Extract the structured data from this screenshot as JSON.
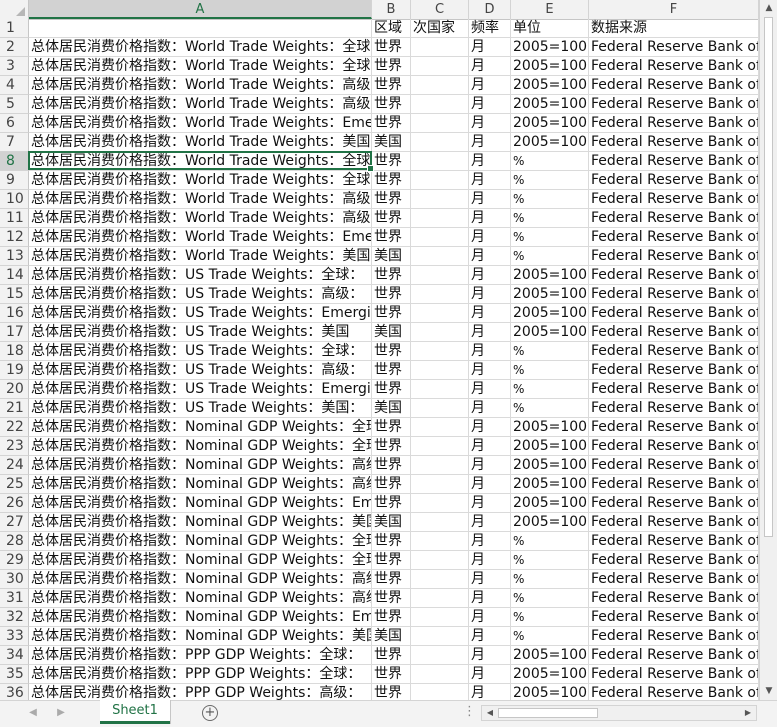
{
  "columns": [
    {
      "letter": "A"
    },
    {
      "letter": "B"
    },
    {
      "letter": "C"
    },
    {
      "letter": "D"
    },
    {
      "letter": "E"
    },
    {
      "letter": "F"
    }
  ],
  "headers": {
    "A": "",
    "B": "区域",
    "C": "次国家",
    "D": "频率",
    "E": "单位",
    "F": "数据来源"
  },
  "rows": [
    {
      "n": "2",
      "a": "总体居民消费价格指数：World Trade Weights：全球",
      "b": "世界",
      "c": "",
      "d": "月",
      "e": "2005=100",
      "f": "Federal Reserve Bank of Dallas"
    },
    {
      "n": "3",
      "a": "总体居民消费价格指数：World Trade Weights：全球",
      "b": "世界",
      "c": "",
      "d": "月",
      "e": "2005=100",
      "f": "Federal Reserve Bank of Dallas"
    },
    {
      "n": "4",
      "a": "总体居民消费价格指数：World Trade Weights：高级",
      "b": "世界",
      "c": "",
      "d": "月",
      "e": "2005=100",
      "f": "Federal Reserve Bank of Dallas"
    },
    {
      "n": "5",
      "a": "总体居民消费价格指数：World Trade Weights：高级",
      "b": "世界",
      "c": "",
      "d": "月",
      "e": "2005=100",
      "f": "Federal Reserve Bank of Dallas"
    },
    {
      "n": "6",
      "a": "总体居民消费价格指数：World Trade Weights：Emerging",
      "b": "世界",
      "c": "",
      "d": "月",
      "e": "2005=100",
      "f": "Federal Reserve Bank of Dallas"
    },
    {
      "n": "7",
      "a": "总体居民消费价格指数：World Trade Weights：美国",
      "b": "美国",
      "c": "",
      "d": "月",
      "e": "2005=100",
      "f": "Federal Reserve Bank of Dallas"
    },
    {
      "n": "8",
      "a": "总体居民消费价格指数：World Trade Weights：全球",
      "b": "世界",
      "c": "",
      "d": "月",
      "e": "%",
      "f": "Federal Reserve Bank of Dallas"
    },
    {
      "n": "9",
      "a": "总体居民消费价格指数：World Trade Weights：全球",
      "b": "世界",
      "c": "",
      "d": "月",
      "e": "%",
      "f": "Federal Reserve Bank of Dallas"
    },
    {
      "n": "10",
      "a": "总体居民消费价格指数：World Trade Weights：高级",
      "b": "世界",
      "c": "",
      "d": "月",
      "e": "%",
      "f": "Federal Reserve Bank of Dallas"
    },
    {
      "n": "11",
      "a": "总体居民消费价格指数：World Trade Weights：高级",
      "b": "世界",
      "c": "",
      "d": "月",
      "e": "%",
      "f": "Federal Reserve Bank of Dallas"
    },
    {
      "n": "12",
      "a": "总体居民消费价格指数：World Trade Weights：Emerging",
      "b": "世界",
      "c": "",
      "d": "月",
      "e": "%",
      "f": "Federal Reserve Bank of Dallas"
    },
    {
      "n": "13",
      "a": "总体居民消费价格指数：World Trade Weights：美国",
      "b": "美国",
      "c": "",
      "d": "月",
      "e": "%",
      "f": "Federal Reserve Bank of Dallas"
    },
    {
      "n": "14",
      "a": "总体居民消费价格指数：US Trade Weights：全球：",
      "b": "世界",
      "c": "",
      "d": "月",
      "e": "2005=100",
      "f": "Federal Reserve Bank of Dallas"
    },
    {
      "n": "15",
      "a": "总体居民消费价格指数：US Trade Weights：高级：",
      "b": "世界",
      "c": "",
      "d": "月",
      "e": "2005=100",
      "f": "Federal Reserve Bank of Dallas"
    },
    {
      "n": "16",
      "a": "总体居民消费价格指数：US Trade Weights：Emerging",
      "b": "世界",
      "c": "",
      "d": "月",
      "e": "2005=100",
      "f": "Federal Reserve Bank of Dallas"
    },
    {
      "n": "17",
      "a": "总体居民消费价格指数：US Trade Weights：美国",
      "b": "美国",
      "c": "",
      "d": "月",
      "e": "2005=100",
      "f": "Federal Reserve Bank of Dallas"
    },
    {
      "n": "18",
      "a": "总体居民消费价格指数：US Trade Weights：全球：",
      "b": "世界",
      "c": "",
      "d": "月",
      "e": "%",
      "f": "Federal Reserve Bank of Dallas"
    },
    {
      "n": "19",
      "a": "总体居民消费价格指数：US Trade Weights：高级：",
      "b": "世界",
      "c": "",
      "d": "月",
      "e": "%",
      "f": "Federal Reserve Bank of Dallas"
    },
    {
      "n": "20",
      "a": "总体居民消费价格指数：US Trade Weights：Emerging",
      "b": "世界",
      "c": "",
      "d": "月",
      "e": "%",
      "f": "Federal Reserve Bank of Dallas"
    },
    {
      "n": "21",
      "a": "总体居民消费价格指数：US Trade Weights：美国：",
      "b": "美国",
      "c": "",
      "d": "月",
      "e": "%",
      "f": "Federal Reserve Bank of Dallas"
    },
    {
      "n": "22",
      "a": "总体居民消费价格指数：Nominal GDP Weights：全球",
      "b": "世界",
      "c": "",
      "d": "月",
      "e": "2005=100",
      "f": "Federal Reserve Bank of Dallas"
    },
    {
      "n": "23",
      "a": "总体居民消费价格指数：Nominal GDP Weights：全球",
      "b": "世界",
      "c": "",
      "d": "月",
      "e": "2005=100",
      "f": "Federal Reserve Bank of Dallas"
    },
    {
      "n": "24",
      "a": "总体居民消费价格指数：Nominal GDP Weights：高级",
      "b": "世界",
      "c": "",
      "d": "月",
      "e": "2005=100",
      "f": "Federal Reserve Bank of Dallas"
    },
    {
      "n": "25",
      "a": "总体居民消费价格指数：Nominal GDP Weights：高级",
      "b": "世界",
      "c": "",
      "d": "月",
      "e": "2005=100",
      "f": "Federal Reserve Bank of Dallas"
    },
    {
      "n": "26",
      "a": "总体居民消费价格指数：Nominal GDP Weights：Emerging",
      "b": "世界",
      "c": "",
      "d": "月",
      "e": "2005=100",
      "f": "Federal Reserve Bank of Dallas"
    },
    {
      "n": "27",
      "a": "总体居民消费价格指数：Nominal GDP Weights：美国",
      "b": "美国",
      "c": "",
      "d": "月",
      "e": "2005=100",
      "f": "Federal Reserve Bank of Dallas"
    },
    {
      "n": "28",
      "a": "总体居民消费价格指数：Nominal GDP Weights：全球",
      "b": "世界",
      "c": "",
      "d": "月",
      "e": "%",
      "f": "Federal Reserve Bank of Dallas"
    },
    {
      "n": "29",
      "a": "总体居民消费价格指数：Nominal GDP Weights：全球",
      "b": "世界",
      "c": "",
      "d": "月",
      "e": "%",
      "f": "Federal Reserve Bank of Dallas"
    },
    {
      "n": "30",
      "a": "总体居民消费价格指数：Nominal GDP Weights：高级",
      "b": "世界",
      "c": "",
      "d": "月",
      "e": "%",
      "f": "Federal Reserve Bank of Dallas"
    },
    {
      "n": "31",
      "a": "总体居民消费价格指数：Nominal GDP Weights：高级",
      "b": "世界",
      "c": "",
      "d": "月",
      "e": "%",
      "f": "Federal Reserve Bank of Dallas"
    },
    {
      "n": "32",
      "a": "总体居民消费价格指数：Nominal GDP Weights：Emerging",
      "b": "世界",
      "c": "",
      "d": "月",
      "e": "%",
      "f": "Federal Reserve Bank of Dallas"
    },
    {
      "n": "33",
      "a": "总体居民消费价格指数：Nominal GDP Weights：美国",
      "b": "美国",
      "c": "",
      "d": "月",
      "e": "%",
      "f": "Federal Reserve Bank of Dallas"
    },
    {
      "n": "34",
      "a": "总体居民消费价格指数：PPP GDP Weights：全球：",
      "b": "世界",
      "c": "",
      "d": "月",
      "e": "2005=100",
      "f": "Federal Reserve Bank of Dallas"
    },
    {
      "n": "35",
      "a": "总体居民消费价格指数：PPP GDP Weights：全球：",
      "b": "世界",
      "c": "",
      "d": "月",
      "e": "2005=100",
      "f": "Federal Reserve Bank of Dallas"
    },
    {
      "n": "36",
      "a": "总体居民消费价格指数：PPP GDP Weights：高级：",
      "b": "世界",
      "c": "",
      "d": "月",
      "e": "2005=100",
      "f": "Federal Reserve Bank of Dallas"
    }
  ],
  "row1_label": "1",
  "sheet_tab": "Sheet1",
  "add_sheet": "+",
  "dots": "⋮",
  "colors": {
    "accent": "#217346"
  }
}
